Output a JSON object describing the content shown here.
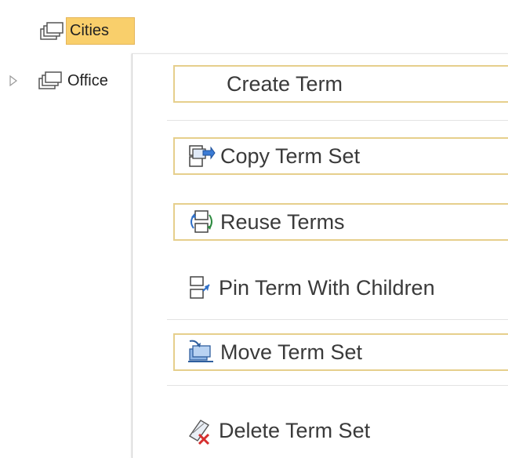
{
  "tree": {
    "nodes": [
      {
        "label": "Cities",
        "selected": true,
        "icon": "term-set-icon"
      },
      {
        "label": "Office",
        "selected": false,
        "icon": "term-set-icon",
        "expander": "expand-arrow-icon"
      }
    ]
  },
  "context_menu": {
    "items": [
      {
        "label": "Create Term",
        "icon": ""
      },
      {
        "label": "Copy Term Set",
        "icon": "copy-term-set-icon"
      },
      {
        "label": "Reuse Terms",
        "icon": "reuse-terms-icon"
      },
      {
        "label": "Pin Term With Children",
        "icon": "pin-term-icon"
      },
      {
        "label": "Move Term Set",
        "icon": "move-term-set-icon"
      },
      {
        "label": "Delete Term Set",
        "icon": "delete-term-set-icon"
      }
    ]
  },
  "colors": {
    "selection": "#f9cf6b",
    "item_border": "#e6cf8c"
  }
}
